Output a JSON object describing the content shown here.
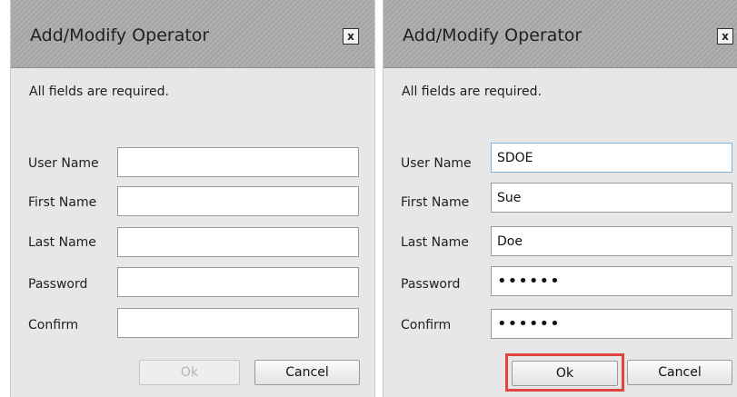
{
  "left_dialog": {
    "title": "Add/Modify Operator",
    "close_label": "x",
    "subtitle": "All fields are required.",
    "fields": [
      {
        "label": "User Name",
        "value": ""
      },
      {
        "label": "First Name",
        "value": ""
      },
      {
        "label": "Last Name",
        "value": ""
      },
      {
        "label": "Password",
        "value": ""
      },
      {
        "label": "Confirm",
        "value": ""
      }
    ],
    "ok_label": "Ok",
    "ok_state": "disabled",
    "cancel_label": "Cancel"
  },
  "right_dialog": {
    "title": "Add/Modify Operator",
    "close_label": "x",
    "subtitle": "All fields are required.",
    "fields": [
      {
        "label": "User Name",
        "value": "SDOE"
      },
      {
        "label": "First Name",
        "value": "Sue"
      },
      {
        "label": "Last Name",
        "value": "Doe"
      },
      {
        "label": "Password",
        "value": "••••••"
      },
      {
        "label": "Confirm",
        "value": "••••••"
      }
    ],
    "ok_label": "Ok",
    "ok_state": "highlighted",
    "highlight_color": "#e0463b",
    "cancel_label": "Cancel"
  }
}
